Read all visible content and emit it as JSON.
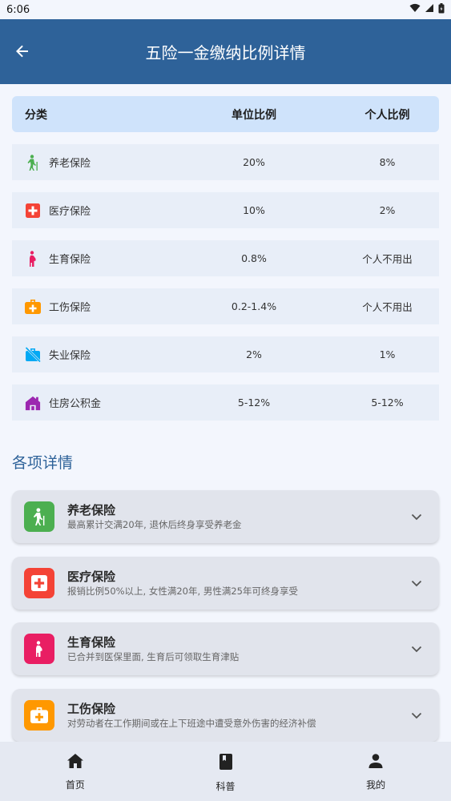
{
  "status_bar": {
    "time": "6:06"
  },
  "app_bar": {
    "title": "五险一金缴纳比例详情"
  },
  "table": {
    "headers": {
      "category": "分类",
      "unit": "单位比例",
      "personal": "个人比例"
    },
    "rows": [
      {
        "name": "养老保险",
        "unit": "20%",
        "personal": "8%",
        "icon": "elderly-icon",
        "color": "#4caf50"
      },
      {
        "name": "医疗保险",
        "unit": "10%",
        "personal": "2%",
        "icon": "medical-cross-icon",
        "color": "#f44336"
      },
      {
        "name": "生育保险",
        "unit": "0.8%",
        "personal": "个人不用出",
        "icon": "pregnant-woman-icon",
        "color": "#e91e63"
      },
      {
        "name": "工伤保险",
        "unit": "0.2-1.4%",
        "personal": "个人不用出",
        "icon": "medical-kit-icon",
        "color": "#ff9800"
      },
      {
        "name": "失业保险",
        "unit": "2%",
        "personal": "1%",
        "icon": "work-off-icon",
        "color": "#03a9f4"
      },
      {
        "name": "住房公积金",
        "unit": "5-12%",
        "personal": "5-12%",
        "icon": "house-icon",
        "color": "#9c27b0"
      }
    ]
  },
  "details": {
    "title": "各项详情",
    "cards": [
      {
        "title": "养老保险",
        "subtitle": "最高累计交满20年, 退休后终身享受养老金",
        "icon": "elderly-icon",
        "color": "#4caf50"
      },
      {
        "title": "医疗保险",
        "subtitle": "报销比例50%以上, 女性满20年, 男性满25年可终身享受",
        "icon": "medical-cross-icon",
        "color": "#f44336"
      },
      {
        "title": "生育保险",
        "subtitle": "已合并到医保里面, 生育后可领取生育津贴",
        "icon": "pregnant-woman-icon",
        "color": "#e91e63"
      },
      {
        "title": "工伤保险",
        "subtitle": "对劳动者在工作期间或在上下班途中遭受意外伤害的经济补偿",
        "icon": "medical-kit-icon",
        "color": "#ff9800"
      }
    ]
  },
  "bottom_nav": {
    "items": [
      {
        "label": "首页",
        "icon": "home-icon"
      },
      {
        "label": "科普",
        "icon": "book-icon"
      },
      {
        "label": "我的",
        "icon": "person-icon"
      }
    ]
  }
}
